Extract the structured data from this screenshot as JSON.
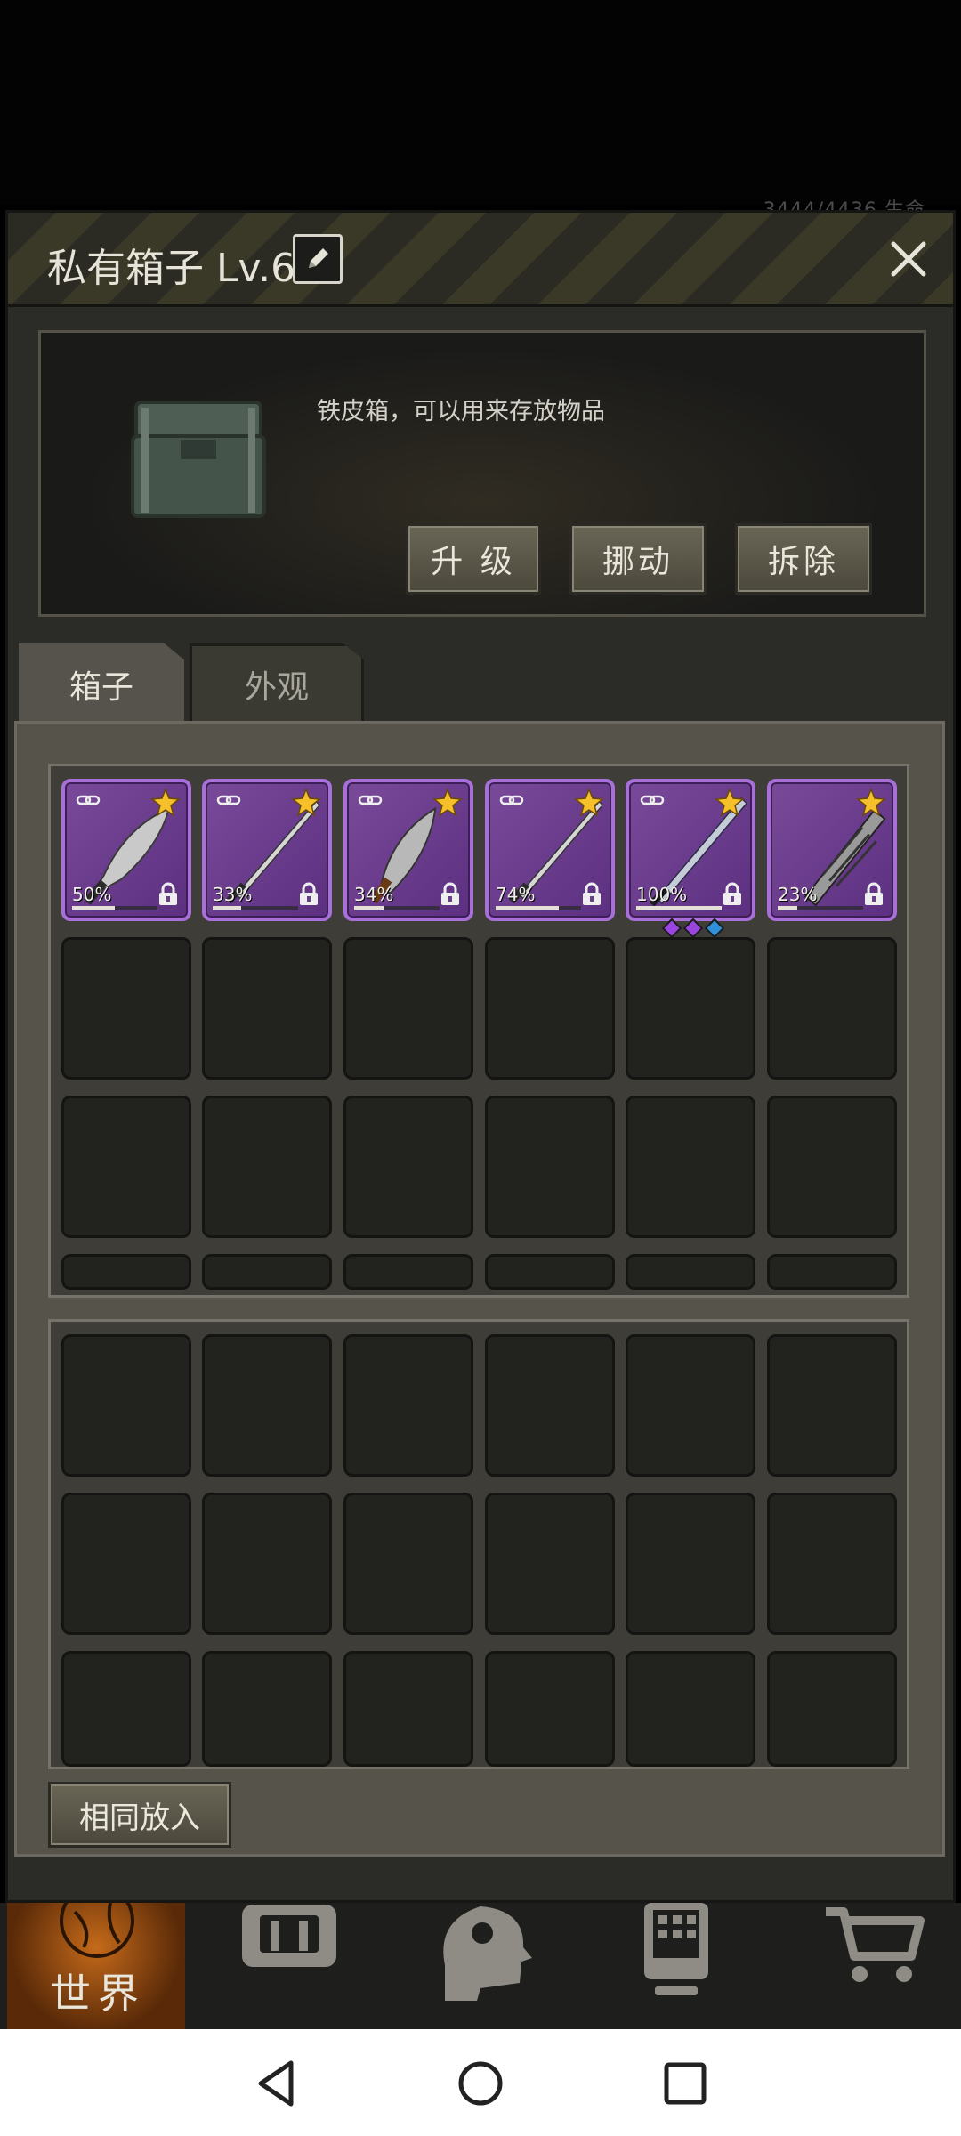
{
  "status_peek": "3444/4436   生命",
  "header": {
    "title": "私有箱子 Lv.6"
  },
  "info": {
    "description": "铁皮箱，可以用来存放物品",
    "buttons": [
      "升 级",
      "挪动",
      "拆除"
    ]
  },
  "tabs": [
    "箱子",
    "外观"
  ],
  "items": [
    {
      "weapon": "machete",
      "durability": "50%",
      "durability_fraction": 0.5,
      "starred": true,
      "bound": true,
      "locked": true
    },
    {
      "weapon": "katana",
      "durability": "33%",
      "durability_fraction": 0.33,
      "starred": true,
      "bound": true,
      "locked": true
    },
    {
      "weapon": "scimitar",
      "durability": "34%",
      "durability_fraction": 0.34,
      "starred": true,
      "bound": true,
      "locked": true
    },
    {
      "weapon": "katana",
      "durability": "74%",
      "durability_fraction": 0.74,
      "starred": true,
      "bound": true,
      "locked": true
    },
    {
      "weapon": "longsword",
      "durability": "100%",
      "durability_fraction": 1.0,
      "starred": true,
      "bound": true,
      "locked": true,
      "gems": [
        "#9a45e0",
        "#9a45e0",
        "#2f8fd8"
      ]
    },
    {
      "weapon": "wrapped-blade",
      "durability": "23%",
      "durability_fraction": 0.23,
      "starred": true,
      "bound": false,
      "locked": true
    }
  ],
  "same_put_button": "相同放入",
  "bottom_nav": {
    "world_label": "世界",
    "icons": [
      "backpack-icon",
      "skills-head-icon",
      "phone-icon",
      "shop-cart-icon"
    ]
  },
  "colors": {
    "item_bg": "#6a3c8c",
    "item_border": "#a86fd8",
    "panel": "#2b2b27",
    "accent_orange": "#c56a1a"
  }
}
